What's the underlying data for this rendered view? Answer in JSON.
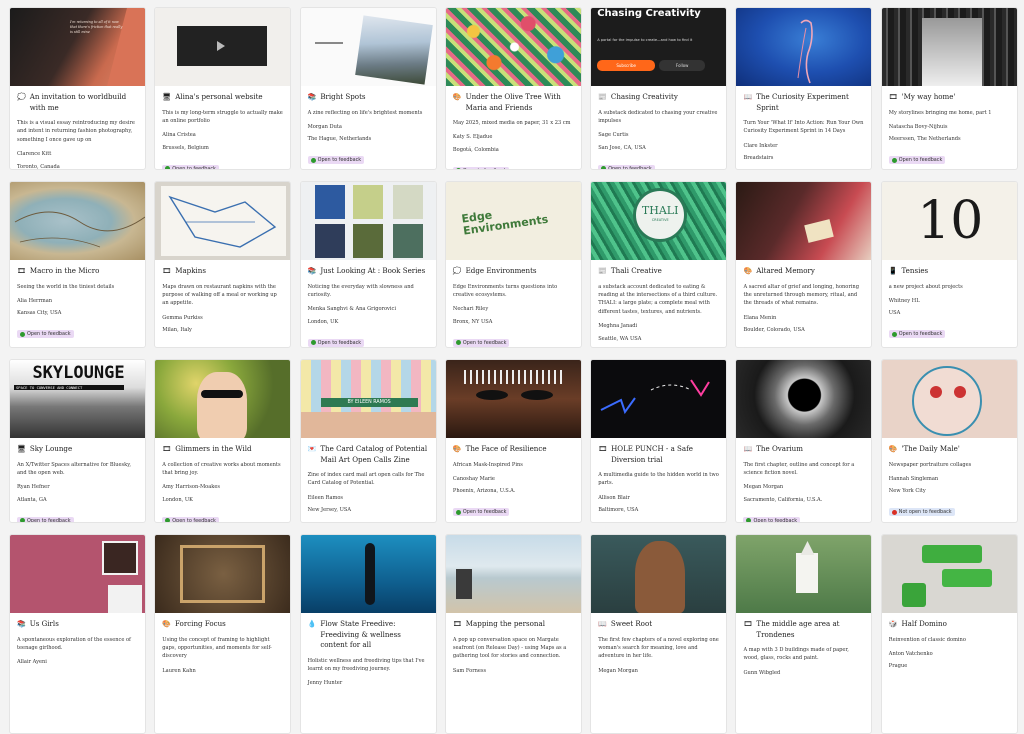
{
  "badge_colors": {
    "open": "#ead9f4",
    "not_open": "#dde6f7",
    "dot_open": "#2e9a2e",
    "dot_not_open": "#d93025"
  },
  "rows": [
    [
      {
        "icon": "speech-bubble",
        "title": "An invitation to worldbuild with me",
        "desc": "This is a visual essay reintroducing my desire and intent in returning fashion photography, something I once gave up on",
        "meta": [
          "Clarence Kitt",
          "Toronto, Canada"
        ],
        "badge": "Open to feedback",
        "open": true,
        "thumb": "figure-on-orange",
        "thumb_text": "I'm returning to all of it now that there's friction that really is still mine"
      },
      {
        "icon": "desktop",
        "title": "Alina's personal website",
        "desc": "This is my long-term struggle to actually make an online portfolio",
        "meta": [
          "Alina Cristea",
          "Brussels, Belgium"
        ],
        "badge": "Open to feedback",
        "open": true,
        "thumb": "video-embed-page",
        "thumb_text": ""
      },
      {
        "icon": "book",
        "title": "Bright Spots",
        "desc": "A zine reflecting on life's brightest moments",
        "meta": [
          "Morgan Duta",
          "The Hague, Netherlands"
        ],
        "badge": "Open to feedback",
        "open": true,
        "thumb": "zine-sky-photo",
        "thumb_text": ""
      },
      {
        "icon": "palette",
        "title": "Under the Olive Tree With Maria and Friends",
        "desc": "May 2025, mixed media on paper, 31 x 23 cm",
        "meta": [
          "Katy S. Eljadue",
          "Bogotá, Colombia"
        ],
        "badge": "Open to feedback",
        "open": true,
        "thumb": "colorful-painting",
        "thumb_text": ""
      },
      {
        "icon": "newspaper",
        "title": "Chasing Creativity",
        "desc": "A substack dedicated to chasing your creative impulses",
        "meta": [
          "Sage Curtis",
          "San Jose, CA, USA"
        ],
        "badge": "Open to feedback",
        "open": true,
        "thumb": "substack-page",
        "thumb_text": "Chasing Creativity",
        "thumb_sub": "A portal for the impulse to create—and how to find it",
        "thumb_btn1": "Subscribe",
        "thumb_btn2": "Follow"
      },
      {
        "icon": "open-book",
        "title": "The Curiosity Experiment Sprint",
        "desc": "Turn Your 'What If' Into Action: Run Your Own Curiosity Experiment Sprint in 14 Days",
        "meta": [
          "Clare Inkster",
          "Breadstairs"
        ],
        "badge": "Open to feedback",
        "open": true,
        "thumb": "jellyfish-blue",
        "thumb_text": ""
      },
      {
        "icon": "screen",
        "title": "'My way home'",
        "desc": "My storylines bringing me home, part 1",
        "meta": [
          "Natascha Bovy-Nijhuis",
          "Meerssen, The Netherlands"
        ],
        "badge": "Open to feedback",
        "open": true,
        "thumb": "staircase-bw",
        "thumb_text": ""
      }
    ],
    [
      {
        "icon": "screen",
        "title": "Macro in the Micro",
        "desc": "Seeing the world in the tiniest details",
        "meta": [
          "Alia Herrman",
          "Kansas City, USA"
        ],
        "badge": "Open to feedback",
        "open": true,
        "thumb": "old-map",
        "thumb_text": ""
      },
      {
        "icon": "screen",
        "title": "Mapkins",
        "desc": "Maps drawn on restaurant napkins with the purpose of walking off a meal or working up an appetite.",
        "meta": [
          "Gemma Purkiss",
          "Milan, Italy"
        ],
        "badge": "Open to feedback",
        "open": true,
        "thumb": "napkin-map",
        "thumb_text": ""
      },
      {
        "icon": "book",
        "title": "Just Looking At : Book Series",
        "desc": "Noticing the everyday with slowness and curiosity.",
        "meta": [
          "Menka Sanghvi & Ana Grigorovici",
          "London, UK"
        ],
        "badge": "Open to feedback",
        "open": true,
        "thumb": "book-covers",
        "thumb_text": ""
      },
      {
        "icon": "speech-bubble",
        "title": "Edge Environments",
        "desc": "Edge Environments turns questions into creative ecosystems.",
        "meta": [
          "Nechari Riley",
          "Bronx, NY USA"
        ],
        "badge": "Open to feedback",
        "open": true,
        "thumb": "edge-logo",
        "thumb_text": "Edge Environments"
      },
      {
        "icon": "newspaper",
        "title": "Thali Creative",
        "desc": "a substack account dedicated to eating & reading at the intersections of a third culture. THALI: a large plate; a complete meal with different tastes, textures, and nutrients.",
        "meta": [
          "Meghna Janadi",
          "Seattle, WA USA"
        ],
        "badge": "Open to feedback",
        "open": true,
        "thumb": "thali-logo",
        "thumb_text": "THALI",
        "thumb_sub": "CREATIVE"
      },
      {
        "icon": "palette",
        "title": "Altared Memory",
        "desc": "A sacred altar of grief and longing, honoring the unreturned through memory, ritual, and the threads of what remains.",
        "meta": [
          "Elana Menin",
          "Boulder, Colorado, USA"
        ],
        "badge": "Open to feedback",
        "open": true,
        "thumb": "altar-photo",
        "thumb_text": ""
      },
      {
        "icon": "mobile",
        "title": "Tensies",
        "desc": "a new project about projects",
        "meta": [
          "Whitney HL",
          "USA"
        ],
        "badge": "Open to feedback",
        "open": true,
        "thumb": "number-ten",
        "thumb_text": "10"
      }
    ],
    [
      {
        "icon": "desktop",
        "title": "Sky Lounge",
        "desc": "An X/Twitter Spaces alternative for Bluesky, and the open web.",
        "meta": [
          "Ryan Hefner",
          "Atlanta, GA"
        ],
        "badge": "Open to feedback",
        "open": true,
        "thumb": "skylounge-banner",
        "thumb_text": "SKYLOUNGE",
        "thumb_sub": "SPACE TO CONVERSE AND CONNECT"
      },
      {
        "icon": "screen",
        "title": "Glimmers in the Wild",
        "desc": "A collection of creative works about moments that bring joy.",
        "meta": [
          "Amy Harrison-Moakes",
          "London, UK"
        ],
        "badge": "Open to feedback",
        "open": true,
        "thumb": "portrait-sunglasses",
        "thumb_text": ""
      },
      {
        "icon": "love-letter",
        "title": "The Card Catalog of Potential Mail Art Open Calls Zine",
        "desc": "Zine of index card mail art open calls for The Card Catalog of Potential.",
        "meta": [
          "Eileen Ramos",
          "New Jersey, USA"
        ],
        "badge": "Open to feedback",
        "open": true,
        "thumb": "card-catalog",
        "thumb_text": "BY EILEEN RAMOS"
      },
      {
        "icon": "palette",
        "title": "The Face of Resilience",
        "desc": "African Mask-Inspired Pins",
        "meta": [
          "Canoshay Marie",
          "Phoenix, Arizona, U.S.A."
        ],
        "badge": "Open to feedback",
        "open": true,
        "thumb": "painted-face",
        "thumb_text": ""
      },
      {
        "icon": "screen",
        "title": "HOLE PUNCH - a Safe Diversion trial",
        "desc": "A multimedia guide to the hidden world in two parts.",
        "meta": [
          "Allison Blair",
          "Baltimore, USA"
        ],
        "badge": "Open to feedback",
        "open": true,
        "thumb": "neon-arrows",
        "thumb_text": ""
      },
      {
        "icon": "open-book",
        "title": "The Ovarium",
        "desc": "The first chapter, outline and concept for a science fiction novel.",
        "meta": [
          "Megan Morgan",
          "Sacramento, California, U.S.A."
        ],
        "badge": "Open to feedback",
        "open": true,
        "thumb": "space-vortex",
        "thumb_text": ""
      },
      {
        "icon": "palette",
        "title": "'The Daily Male'",
        "desc": "Newspaper portraiture collages",
        "meta": [
          "Hannah Singleman",
          "New York City"
        ],
        "badge": "Not open to feedback",
        "open": false,
        "thumb": "collage-face",
        "thumb_text": ""
      }
    ],
    [
      {
        "icon": "book",
        "title": "Us Girls",
        "desc": "A spontaneous exploration of the essence of teenage girlhood.",
        "meta": [
          "Allair Ayeni"
        ],
        "badge": "",
        "open": true,
        "thumb": "pink-photos",
        "thumb_text": ""
      },
      {
        "icon": "palette",
        "title": "Forcing Focus",
        "desc": "Using the concept of framing to highlight gaps, opportunities, and moments for self-discovery",
        "meta": [
          "Lauren Kahn"
        ],
        "badge": "",
        "open": true,
        "thumb": "framed-objects",
        "thumb_text": ""
      },
      {
        "icon": "water-drop",
        "title": "Flow State Freedive: Freediving & wellness content for all",
        "desc": "Holistic wellness and freediving tips that I've learnt on my freediving journey.",
        "meta": [
          "Jenny Hunter"
        ],
        "badge": "",
        "open": true,
        "thumb": "underwater-diver",
        "thumb_text": ""
      },
      {
        "icon": "screen",
        "title": "Mapping the personal",
        "desc": "A pop up conversation space on Margate seafront (on Release Day) - using Maps as a gathering tool for stories and connection.",
        "meta": [
          "Sam Forness"
        ],
        "badge": "",
        "open": true,
        "thumb": "beach-scene",
        "thumb_text": ""
      },
      {
        "icon": "open-book",
        "title": "Sweet Root",
        "desc": "The first few chapters of a novel exploring one woman's search for meaning, love and adventure in her life.",
        "meta": [
          "Megan Morgan"
        ],
        "badge": "",
        "open": true,
        "thumb": "woman-portrait",
        "thumb_text": ""
      },
      {
        "icon": "screen",
        "title": "The middle age area at Trondenes",
        "desc": "A map with 3 D buildings made of paper, wood, glass, rocks and paint.",
        "meta": [
          "Gunn Wibgled"
        ],
        "badge": "",
        "open": true,
        "thumb": "paper-model",
        "thumb_text": ""
      },
      {
        "icon": "dice",
        "title": "Half Domino",
        "desc": "Reinvention of classic domino",
        "meta": [
          "Anton Vatchenko",
          "Prague"
        ],
        "badge": "",
        "open": true,
        "thumb": "green-dominoes",
        "thumb_text": ""
      }
    ]
  ]
}
